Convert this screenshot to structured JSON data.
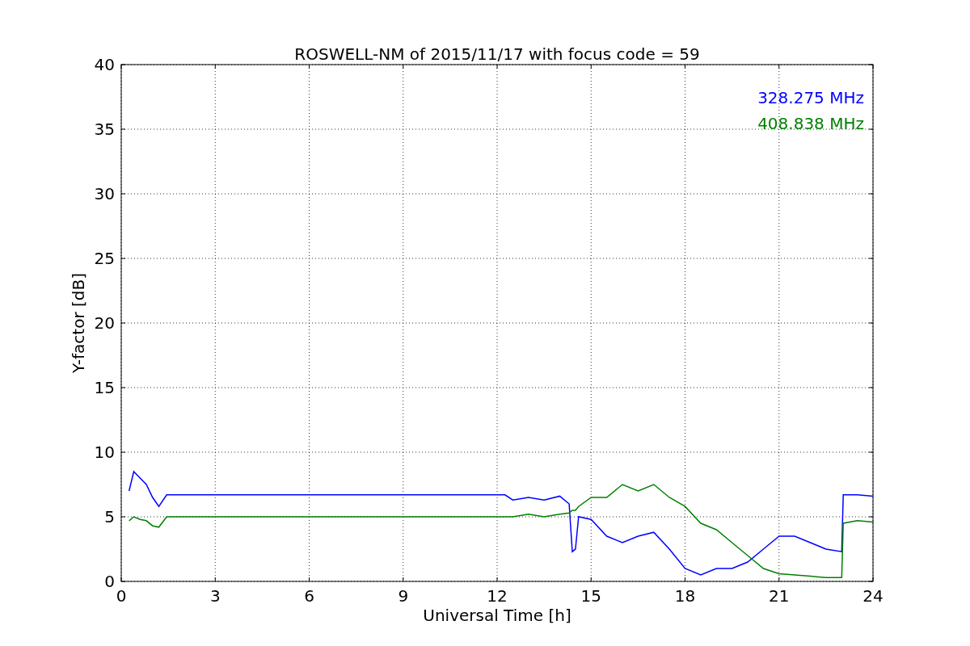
{
  "chart_data": {
    "type": "line",
    "title": "ROSWELL-NM of 2015/11/17 with focus code = 59",
    "xlabel": "Universal Time [h]",
    "ylabel": "Y-factor [dB]",
    "x": [
      0.25,
      0.4,
      0.6,
      0.8,
      1.0,
      1.2,
      1.45,
      3,
      6,
      9,
      12.25,
      12.5,
      13,
      13.5,
      14,
      14.3,
      14.4,
      14.5,
      14.6,
      15,
      15.5,
      16,
      16.5,
      17,
      17.5,
      18,
      18.5,
      19,
      19.5,
      20,
      20.5,
      21,
      21.5,
      22,
      22.5,
      23,
      23.05,
      23.5,
      24
    ],
    "series": [
      {
        "name": "328.275 MHz",
        "color": "#0000ff",
        "values": [
          7.0,
          8.5,
          8.0,
          7.5,
          6.5,
          5.8,
          6.7,
          6.7,
          6.7,
          6.7,
          6.7,
          6.3,
          6.5,
          6.3,
          6.6,
          6.0,
          2.3,
          2.5,
          5.0,
          4.8,
          3.5,
          3.0,
          3.5,
          3.8,
          2.5,
          1.0,
          0.5,
          1.0,
          1.0,
          1.5,
          2.5,
          3.5,
          3.5,
          3.0,
          2.5,
          2.3,
          6.7,
          6.7,
          6.6
        ]
      },
      {
        "name": "408.838 MHz",
        "color": "#008000",
        "values": [
          4.7,
          5.0,
          4.8,
          4.7,
          4.3,
          4.2,
          5.0,
          5.0,
          5.0,
          5.0,
          5.0,
          5.0,
          5.2,
          5.0,
          5.2,
          5.3,
          5.5,
          5.5,
          5.8,
          6.5,
          6.5,
          7.5,
          7.0,
          7.5,
          6.5,
          5.8,
          4.5,
          4.0,
          3.0,
          2.0,
          1.0,
          0.6,
          0.5,
          0.4,
          0.3,
          0.3,
          4.5,
          4.7,
          4.6
        ]
      }
    ],
    "xlim": [
      0,
      24
    ],
    "ylim": [
      0,
      40
    ],
    "xticks": [
      0,
      3,
      6,
      9,
      12,
      15,
      18,
      21,
      24
    ],
    "yticks": [
      0,
      5,
      10,
      15,
      20,
      25,
      30,
      35,
      40
    ],
    "grid": true
  }
}
